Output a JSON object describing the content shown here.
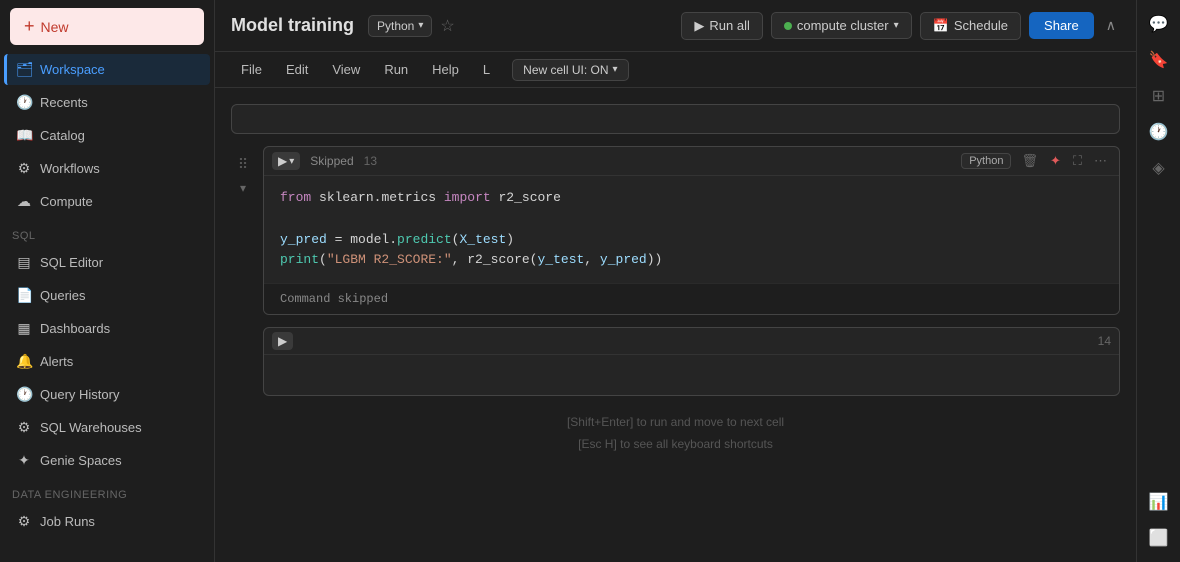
{
  "sidebar": {
    "new_label": "New",
    "items": [
      {
        "id": "workspace",
        "label": "Workspace",
        "icon": "🗂",
        "active": true
      },
      {
        "id": "recents",
        "label": "Recents",
        "icon": "🕐"
      },
      {
        "id": "catalog",
        "label": "Catalog",
        "icon": "📖"
      },
      {
        "id": "workflows",
        "label": "Workflows",
        "icon": "⚙"
      },
      {
        "id": "compute",
        "label": "Compute",
        "icon": "☁"
      }
    ],
    "sql_section": "SQL",
    "sql_items": [
      {
        "id": "sql-editor",
        "label": "SQL Editor",
        "icon": "▤"
      },
      {
        "id": "queries",
        "label": "Queries",
        "icon": "📄"
      },
      {
        "id": "dashboards",
        "label": "Dashboards",
        "icon": "▦"
      },
      {
        "id": "alerts",
        "label": "Alerts",
        "icon": "🔔"
      },
      {
        "id": "query-history",
        "label": "Query History",
        "icon": "🕐"
      },
      {
        "id": "sql-warehouses",
        "label": "SQL Warehouses",
        "icon": "⚙"
      },
      {
        "id": "genie-spaces",
        "label": "Genie Spaces",
        "icon": "✦"
      }
    ],
    "data_engineering_section": "Data Engineering",
    "de_items": [
      {
        "id": "job-runs",
        "label": "Job Runs",
        "icon": "⚙"
      }
    ]
  },
  "topbar": {
    "title": "Model training",
    "language": "Python",
    "run_all_label": "Run all",
    "cluster_label": "compute cluster",
    "schedule_label": "Schedule",
    "share_label": "Share"
  },
  "menubar": {
    "items": [
      "File",
      "Edit",
      "View",
      "Run",
      "Help",
      "L"
    ],
    "new_cell_label": "New cell UI: ON"
  },
  "notebook": {
    "cells": [
      {
        "id": "cell-13",
        "status": "Skipped",
        "number": "13",
        "language": "Python",
        "lines": [
          {
            "type": "code",
            "content": "from sklearn.metrics import r2_score"
          },
          {
            "type": "empty",
            "content": ""
          },
          {
            "type": "code",
            "content": "y_pred = model.predict(X_test)"
          },
          {
            "type": "code",
            "content": "print(\"LGBM R2_SCORE:\", r2_score(y_test, y_pred))"
          }
        ],
        "output": "Command skipped"
      },
      {
        "id": "cell-14",
        "status": "",
        "number": "14",
        "language": "",
        "lines": []
      }
    ],
    "hints": [
      "[Shift+Enter] to run and move to next cell",
      "[Esc H] to see all keyboard shortcuts"
    ]
  },
  "right_sidebar": {
    "icons": [
      "💬",
      "🔖",
      "⊞",
      "🕐",
      "◈",
      "📊"
    ]
  }
}
